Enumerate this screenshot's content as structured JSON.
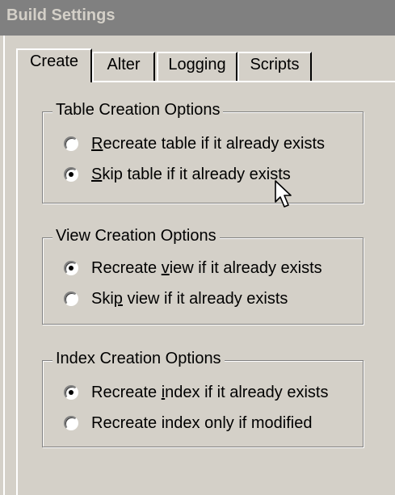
{
  "window": {
    "title": "Build Settings"
  },
  "tabs": [
    {
      "label": "Create",
      "active": true
    },
    {
      "label": "Alter",
      "active": false
    },
    {
      "label": "Logging",
      "active": false
    },
    {
      "label": "Scripts",
      "active": false
    }
  ],
  "groups": {
    "table": {
      "legend": "Table Creation Options",
      "options": [
        {
          "pre": "",
          "u": "R",
          "post": "ecreate table if it already exists",
          "selected": false
        },
        {
          "pre": "",
          "u": "S",
          "post": "kip table if it already exists",
          "selected": true
        }
      ]
    },
    "view": {
      "legend": "View Creation Options",
      "options": [
        {
          "pre": "Recreate ",
          "u": "v",
          "post": "iew if it already exists",
          "selected": true
        },
        {
          "pre": "Ski",
          "u": "p",
          "post": " view if it already exists",
          "selected": false
        }
      ]
    },
    "index": {
      "legend": "Index Creation Options",
      "options": [
        {
          "pre": "Recreate ",
          "u": "i",
          "post": "ndex if it already exists",
          "selected": true
        },
        {
          "pre": "Recreate index only if modified",
          "u": "",
          "post": "",
          "selected": false
        }
      ]
    }
  },
  "icons": {
    "cursor": "mouse-pointer-icon",
    "radio": "radio-button-icon"
  },
  "colors": {
    "face": "#d4d0c8",
    "titlebar": "#808080",
    "title_text": "#d4d0c8"
  }
}
